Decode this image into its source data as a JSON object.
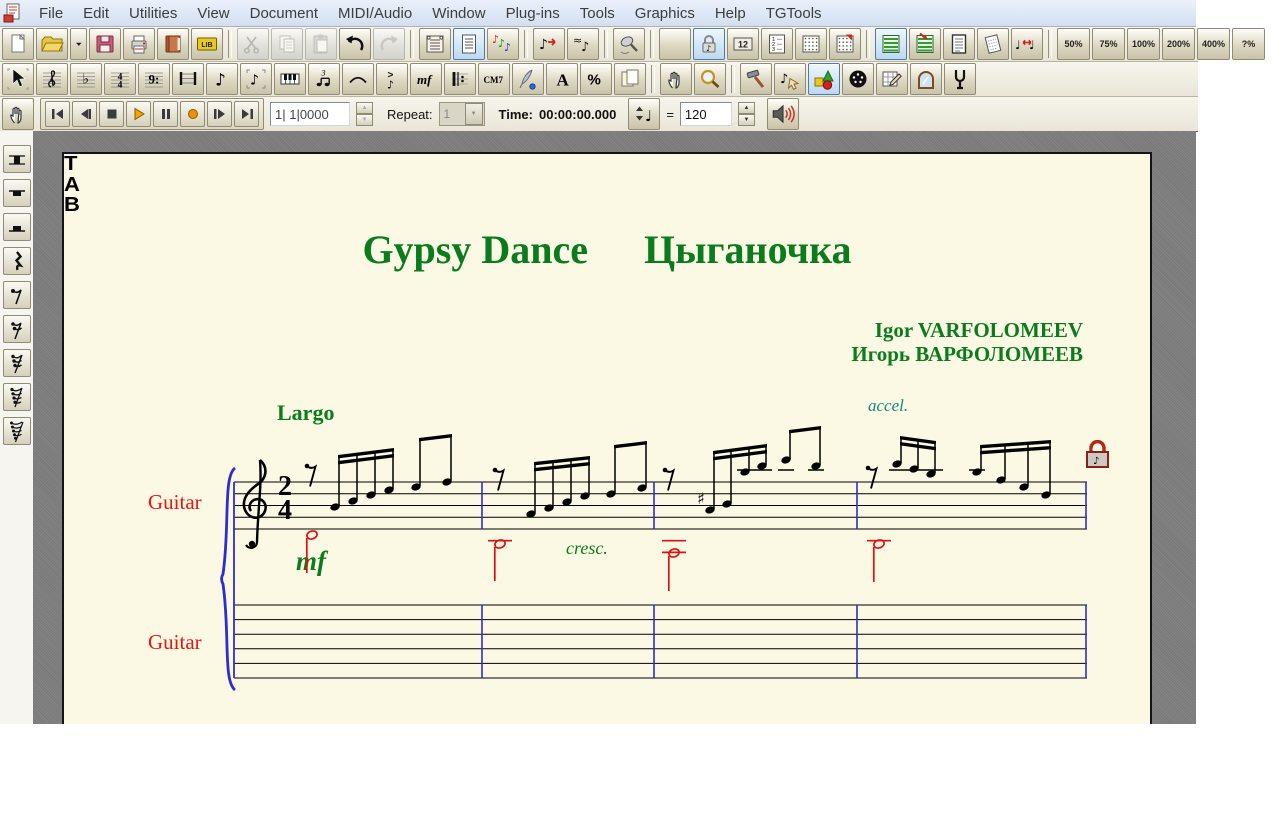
{
  "menu": {
    "items": [
      "File",
      "Edit",
      "Utilities",
      "View",
      "Document",
      "MIDI/Audio",
      "Window",
      "Plug-ins",
      "Tools",
      "Graphics",
      "Help",
      "TGTools"
    ]
  },
  "toolbar1": {
    "groups": [
      [
        {
          "name": "new-document-button",
          "icon": "docnew"
        },
        {
          "name": "open-button",
          "icon": "folder"
        },
        {
          "name": "open-dropdown",
          "icon": "caret",
          "small": true
        },
        {
          "name": "save-button",
          "icon": "floppy"
        },
        {
          "name": "print-button",
          "icon": "printer"
        },
        {
          "name": "launch-window-button",
          "icon": "book"
        },
        {
          "name": "library-button",
          "icon": "lib"
        }
      ],
      [
        {
          "name": "cut-button",
          "icon": "scissors",
          "state": "dis"
        },
        {
          "name": "copy-button",
          "icon": "copy",
          "state": "dis"
        },
        {
          "name": "paste-button",
          "icon": "paste",
          "state": "dis"
        },
        {
          "name": "undo-button",
          "icon": "undo"
        },
        {
          "name": "redo-button",
          "icon": "redo",
          "state": "dis"
        }
      ],
      [
        {
          "name": "scroll-view-button",
          "icon": "scrollview"
        },
        {
          "name": "page-view-button",
          "icon": "pageview",
          "state": "sel"
        },
        {
          "name": "studio-view-button",
          "icon": "studio"
        }
      ],
      [
        {
          "name": "playback-settings-button",
          "icon": "pbnote"
        },
        {
          "name": "human-playback-button",
          "icon": "notetilde"
        }
      ],
      [
        {
          "name": "mic-button",
          "icon": "mic"
        }
      ],
      [
        {
          "name": "blank-button",
          "icon": "blank"
        },
        {
          "name": "edit-lock-button",
          "icon": "locknote",
          "state": "sel"
        },
        {
          "name": "measure-numbers-button",
          "icon": "n12"
        },
        {
          "name": "staff-list-button",
          "icon": "list123"
        },
        {
          "name": "grid-button",
          "icon": "grid"
        },
        {
          "name": "grid-flag-button",
          "icon": "gridflag"
        }
      ],
      [
        {
          "name": "staff-set-button",
          "icon": "staffgreen",
          "state": "sel"
        },
        {
          "name": "staff-set-arrow-button",
          "icon": "staffarrow"
        },
        {
          "name": "doc-lines-button",
          "icon": "doclines"
        },
        {
          "name": "tilted-page-button",
          "icon": "tiltedpage"
        },
        {
          "name": "note-spacing-button",
          "icon": "notespacing"
        }
      ],
      [
        {
          "name": "zoom-50-button",
          "label": "50%"
        },
        {
          "name": "zoom-75-button",
          "label": "75%"
        },
        {
          "name": "zoom-100-button",
          "label": "100%"
        },
        {
          "name": "zoom-200-button",
          "label": "200%"
        },
        {
          "name": "zoom-400-button",
          "label": "400%"
        },
        {
          "name": "zoom-custom-button",
          "label": "?%"
        }
      ]
    ]
  },
  "toolbar2": {
    "groups": [
      [
        {
          "name": "selection-tool",
          "icon": "cursor"
        },
        {
          "name": "staff-tool",
          "icon": "staffclef"
        },
        {
          "name": "key-signature-tool",
          "icon": "keyflat"
        },
        {
          "name": "time-signature-tool",
          "icon": "timesig"
        },
        {
          "name": "clef-tool",
          "icon": "bassclef"
        },
        {
          "name": "measure-tool",
          "icon": "measure"
        },
        {
          "name": "simple-entry-tool",
          "icon": "note8"
        },
        {
          "name": "speedy-entry-tool",
          "icon": "speedy"
        },
        {
          "name": "hyperscribe-tool",
          "icon": "piano"
        },
        {
          "name": "tuplet-tool",
          "icon": "tuplet"
        },
        {
          "name": "smart-shape-tool",
          "icon": "slur"
        },
        {
          "name": "articulation-tool",
          "icon": "artic"
        },
        {
          "name": "expression-tool",
          "icon": "mfi"
        },
        {
          "name": "repeat-tool",
          "icon": "repeat"
        },
        {
          "name": "chord-tool",
          "icon": "cm7"
        },
        {
          "name": "lyrics-tool",
          "icon": "quill"
        },
        {
          "name": "text-tool",
          "icon": "textA"
        },
        {
          "name": "ossia-tool",
          "icon": "percent"
        },
        {
          "name": "page-layout-tool",
          "icon": "pages"
        }
      ],
      [
        {
          "name": "hand-grabber-tool",
          "icon": "hand"
        },
        {
          "name": "zoom-tool",
          "icon": "magnifier"
        }
      ],
      [
        {
          "name": "special-tools",
          "icon": "hammer"
        },
        {
          "name": "note-mover-tool",
          "icon": "notemover"
        },
        {
          "name": "graphics-tool",
          "icon": "shapes",
          "state": "sel"
        },
        {
          "name": "midi-tool",
          "icon": "midiball"
        },
        {
          "name": "tempo-tool",
          "icon": "gridpencil"
        },
        {
          "name": "mirror-tool",
          "icon": "mirror"
        },
        {
          "name": "tuning-fork-tool",
          "icon": "fork"
        }
      ]
    ]
  },
  "playback": {
    "counter_value": "1| 1|0000",
    "repeat_label": "Repeat:",
    "repeat_value": "1",
    "time_label": "Time:",
    "time_value": "00:00:00.000",
    "equals_sign": "=",
    "tempo_value": "120",
    "transport": [
      {
        "name": "go-to-start-button",
        "icon": "tstart"
      },
      {
        "name": "rewind-button",
        "icon": "tback"
      },
      {
        "name": "stop-button",
        "icon": "tstop"
      },
      {
        "name": "play-button",
        "icon": "tplay"
      },
      {
        "name": "pause-button",
        "icon": "tpause"
      },
      {
        "name": "record-button",
        "icon": "trec"
      },
      {
        "name": "forward-button",
        "icon": "tfwd"
      },
      {
        "name": "go-to-end-button",
        "icon": "tend"
      }
    ]
  },
  "rest_palette": {
    "buttons": [
      {
        "name": "double-whole-rest-button",
        "icon": "brest"
      },
      {
        "name": "whole-rest-button",
        "icon": "wrest"
      },
      {
        "name": "half-rest-button",
        "icon": "hrest"
      },
      {
        "name": "quarter-rest-button",
        "icon": "qrest"
      },
      {
        "name": "eighth-rest-button",
        "icon": "r8"
      },
      {
        "name": "sixteenth-rest-button",
        "icon": "r16"
      },
      {
        "name": "thirtysecond-rest-button",
        "icon": "r32"
      },
      {
        "name": "sixtyfourth-rest-button",
        "icon": "r64"
      },
      {
        "name": "onetwentyeighth-rest-button",
        "icon": "r128"
      }
    ]
  },
  "score": {
    "title": "Gypsy Dance",
    "title_ru": "Цыганочка",
    "composer": "Igor VARFOLOMEEV",
    "composer_ru": "Игорь ВАРФОЛОМЕЕВ",
    "tempo_text": "Largo",
    "accel_text": "accel.",
    "cresc_text": "cresc.",
    "dynamic_text": "mf",
    "staff1_label": "Guitar",
    "staff2_label": "Guitar",
    "tab_letters": {
      "t": "T",
      "a": "A",
      "b": "B"
    },
    "time_signature": {
      "numerator": "2",
      "denominator": "4"
    },
    "accidental": "♯",
    "measures": 4,
    "colors": {
      "green": "#0b7c1e",
      "red_label": "#e41512",
      "teal": "#10887a",
      "barline_blue": "#2d2dd2",
      "note_red": "#dd1111"
    }
  }
}
